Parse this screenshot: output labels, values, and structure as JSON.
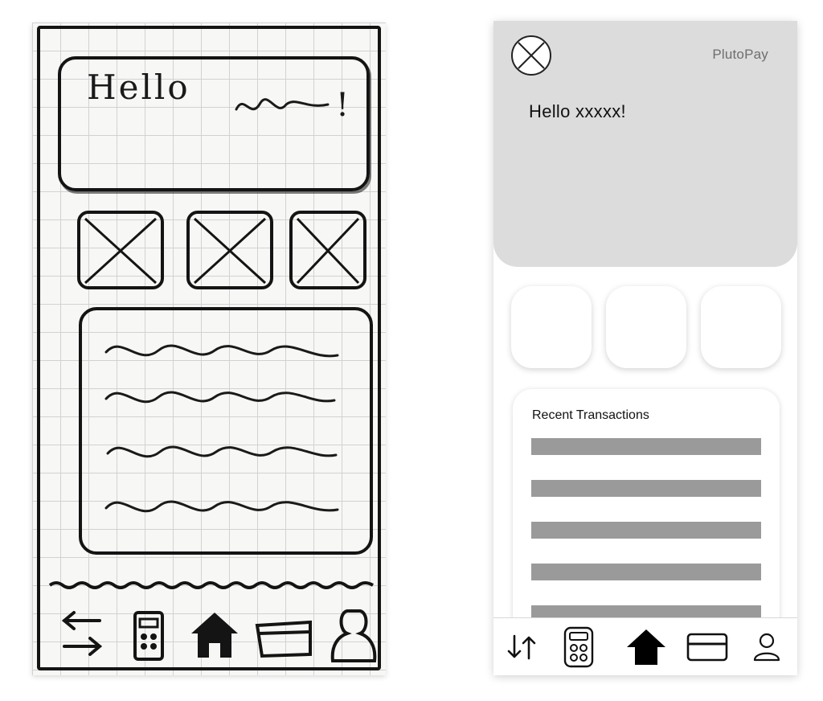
{
  "sketch": {
    "greeting_text": "Hello",
    "greeting_punct": "!"
  },
  "app": {
    "brand_name": "PlutoPay",
    "greeting": "Hello xxxxx!",
    "avatar_icon": "x-circle-placeholder-icon",
    "quick_actions": [
      "action-1",
      "action-2",
      "action-3"
    ],
    "recent_transactions": {
      "title": "Recent Transactions",
      "row_count": 5
    },
    "tab_bar": {
      "items": [
        {
          "name": "transfer",
          "icon": "transfer-arrows-icon",
          "active": false
        },
        {
          "name": "calculator",
          "icon": "calculator-icon",
          "active": false
        },
        {
          "name": "home",
          "icon": "home-icon",
          "active": true
        },
        {
          "name": "cards",
          "icon": "credit-card-icon",
          "active": false
        },
        {
          "name": "profile",
          "icon": "user-icon",
          "active": false
        }
      ]
    }
  },
  "colors": {
    "hero_bg": "#dcdcdc",
    "placeholder_bar": "#9a9a9a",
    "ink": "#111111",
    "brand_text": "#6e6e6e"
  }
}
